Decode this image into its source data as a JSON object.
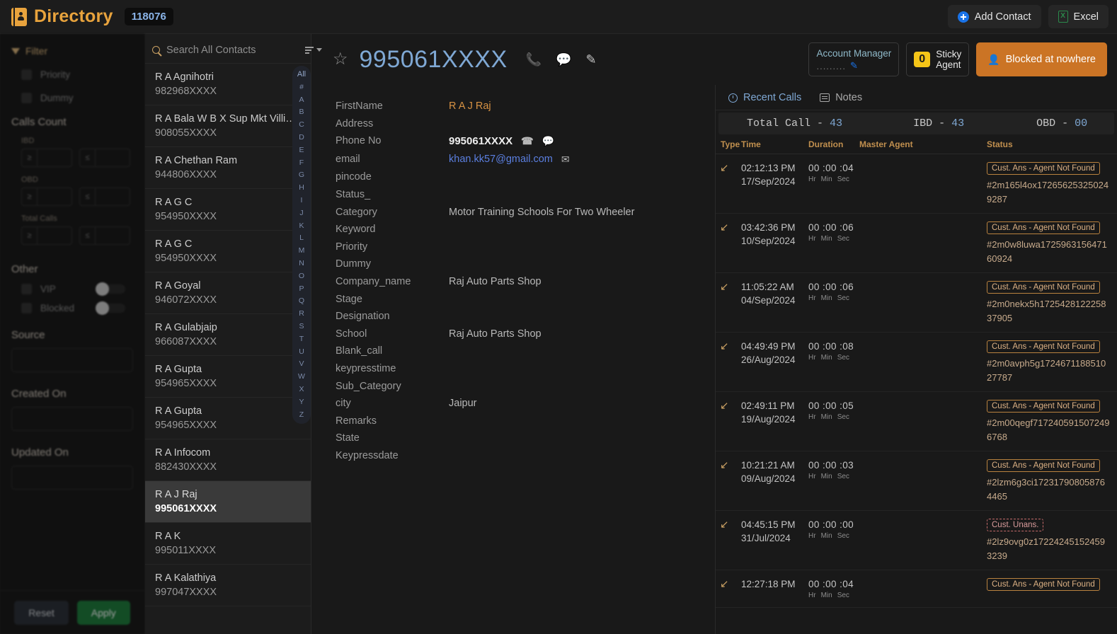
{
  "topbar": {
    "brand_title": "Directory",
    "brand_count": "118076",
    "add_contact_label": "Add Contact",
    "excel_label": "Excel",
    "brand_color": "#e8a33d",
    "count_color": "#8ab4e8"
  },
  "filter": {
    "title": "Filter",
    "checkboxes": [
      {
        "label": "Priority"
      },
      {
        "label": "Dummy"
      }
    ],
    "calls_count_title": "Calls Count",
    "calls_groups": [
      {
        "label": "IBD",
        "op_min": "≥",
        "op_max": "≤",
        "min": "",
        "max": ""
      },
      {
        "label": "OBD",
        "op_min": "≥",
        "op_max": "≤",
        "min": "",
        "max": ""
      },
      {
        "label": "Total Calls",
        "op_min": "≥",
        "op_max": "≤",
        "min": "",
        "max": ""
      }
    ],
    "other_title": "Other",
    "toggles": [
      {
        "label": "VIP"
      },
      {
        "label": "Blocked"
      }
    ],
    "text_fields": [
      {
        "label": "Source",
        "value": ""
      },
      {
        "label": "Created On",
        "value": ""
      },
      {
        "label": "Updated On",
        "value": ""
      }
    ],
    "reset_label": "Reset",
    "apply_label": "Apply"
  },
  "list": {
    "search_placeholder": "Search All Contacts",
    "search_value": "",
    "alpha_index": [
      "All",
      "#",
      "A",
      "B",
      "C",
      "D",
      "E",
      "F",
      "G",
      "H",
      "I",
      "J",
      "K",
      "L",
      "M",
      "N",
      "O",
      "P",
      "Q",
      "R",
      "S",
      "T",
      "U",
      "V",
      "W",
      "X",
      "Y",
      "Z"
    ],
    "contacts": [
      {
        "name": "R A Agnihotri",
        "phone": "982968XXXX",
        "active": false
      },
      {
        "name": "R A Bala W B X Sup Mkt Villivak…",
        "phone": "908055XXXX",
        "active": false
      },
      {
        "name": "R A Chethan Ram",
        "phone": "944806XXXX",
        "active": false
      },
      {
        "name": "R A G C",
        "phone": "954950XXXX",
        "active": false
      },
      {
        "name": "R A G C",
        "phone": "954950XXXX",
        "active": false
      },
      {
        "name": "R A Goyal",
        "phone": "946072XXXX",
        "active": false
      },
      {
        "name": "R A Gulabjaip",
        "phone": "966087XXXX",
        "active": false
      },
      {
        "name": "R A Gupta",
        "phone": "954965XXXX",
        "active": false
      },
      {
        "name": "R A Gupta",
        "phone": "954965XXXX",
        "active": false
      },
      {
        "name": "R A Infocom",
        "phone": "882430XXXX",
        "active": false
      },
      {
        "name": "R A J Raj",
        "phone": "995061XXXX",
        "active": true
      },
      {
        "name": "R A K",
        "phone": "995011XXXX",
        "active": false
      },
      {
        "name": "R A Kalathiya",
        "phone": "997047XXXX",
        "active": false
      }
    ]
  },
  "detail": {
    "phone_title": "995061XXXX",
    "account_manager": {
      "title": "Account Manager",
      "value": "........."
    },
    "sticky": {
      "count": "0",
      "label_line1": "Sticky",
      "label_line2": "Agent"
    },
    "blocked_label": "Blocked at nowhere",
    "blocked_color": "#cb7425",
    "fields": [
      {
        "key": "FirstName",
        "value": "R A J Raj",
        "style": "orange"
      },
      {
        "key": "Address",
        "value": "",
        "style": ""
      },
      {
        "key": "Phone No",
        "value": "995061XXXX",
        "style": "bold",
        "actions": [
          "call-icon",
          "sms-icon"
        ]
      },
      {
        "key": "email",
        "value": "khan.kk57@gmail.com",
        "style": "mail",
        "actions": [
          "mail-icon"
        ]
      },
      {
        "key": "pincode",
        "value": "",
        "style": ""
      },
      {
        "key": "Status_",
        "value": "",
        "style": ""
      },
      {
        "key": "Category",
        "value": "Motor Training Schools For Two Wheeler",
        "style": ""
      },
      {
        "key": "Keyword",
        "value": "",
        "style": ""
      },
      {
        "key": "Priority",
        "value": "",
        "style": ""
      },
      {
        "key": "Dummy",
        "value": "",
        "style": ""
      },
      {
        "key": "Company_name",
        "value": "Raj Auto Parts Shop",
        "style": ""
      },
      {
        "key": "Stage",
        "value": "",
        "style": ""
      },
      {
        "key": "Designation",
        "value": "",
        "style": ""
      },
      {
        "key": "School",
        "value": "Raj Auto Parts Shop",
        "style": ""
      },
      {
        "key": "Blank_call",
        "value": "",
        "style": ""
      },
      {
        "key": "keypresstime",
        "value": "",
        "style": ""
      },
      {
        "key": "Sub_Category",
        "value": "",
        "style": ""
      },
      {
        "key": "city",
        "value": "Jaipur",
        "style": ""
      },
      {
        "key": "Remarks",
        "value": "",
        "style": ""
      },
      {
        "key": "State",
        "value": "",
        "style": ""
      },
      {
        "key": "Keypressdate",
        "value": "",
        "style": ""
      }
    ]
  },
  "calls": {
    "tabs": [
      {
        "label": "Recent Calls",
        "icon": "clock-icon",
        "active": true
      },
      {
        "label": "Notes",
        "icon": "note-icon",
        "active": false
      }
    ],
    "totals": {
      "total_label": "Total Call -",
      "total_value": "43",
      "ibd_label": "IBD -",
      "ibd_value": "43",
      "obd_label": "OBD -",
      "obd_value": "00"
    },
    "columns": [
      "Type",
      "Time",
      "Duration",
      "Master Agent",
      "Status"
    ],
    "duration_units": [
      "Hr",
      "Min",
      "Sec"
    ],
    "rows": [
      {
        "type": "incoming-call-icon",
        "time": "02:12:13 PM",
        "date": "17/Sep/2024",
        "duration": "00 :00 :04",
        "agent": "",
        "status": "Cust. Ans - Agent Not Found",
        "status_kind": "ans",
        "ref": "#2m165l4ox172656253250249287"
      },
      {
        "type": "incoming-call-icon",
        "time": "03:42:36 PM",
        "date": "10/Sep/2024",
        "duration": "00 :00 :06",
        "agent": "",
        "status": "Cust. Ans - Agent Not Found",
        "status_kind": "ans",
        "ref": "#2m0w8luwa172596315647160924"
      },
      {
        "type": "incoming-call-icon",
        "time": "11:05:22 AM",
        "date": "04/Sep/2024",
        "duration": "00 :00 :06",
        "agent": "",
        "status": "Cust. Ans - Agent Not Found",
        "status_kind": "ans",
        "ref": "#2m0nekx5h172542812225837905"
      },
      {
        "type": "incoming-call-icon",
        "time": "04:49:49 PM",
        "date": "26/Aug/2024",
        "duration": "00 :00 :08",
        "agent": "",
        "status": "Cust. Ans - Agent Not Found",
        "status_kind": "ans",
        "ref": "#2m0avph5g172467118851027787"
      },
      {
        "type": "incoming-call-icon",
        "time": "02:49:11 PM",
        "date": "19/Aug/2024",
        "duration": "00 :00 :05",
        "agent": "",
        "status": "Cust. Ans - Agent Not Found",
        "status_kind": "ans",
        "ref": "#2m00qegf7172405915072496768"
      },
      {
        "type": "incoming-call-icon",
        "time": "10:21:21 AM",
        "date": "09/Aug/2024",
        "duration": "00 :00 :03",
        "agent": "",
        "status": "Cust. Ans - Agent Not Found",
        "status_kind": "ans",
        "ref": "#2lzm6g3ci172317908058764465"
      },
      {
        "type": "incoming-call-icon",
        "time": "04:45:15 PM",
        "date": "31/Jul/2024",
        "duration": "00 :00 :00",
        "agent": "",
        "status": "Cust. Unans.",
        "status_kind": "unans",
        "ref": "#2lz9ovg0z172242451524593239"
      },
      {
        "type": "incoming-call-icon",
        "time": "12:27:18 PM",
        "date": "",
        "duration": "00 :00 :04",
        "agent": "",
        "status": "Cust. Ans - Agent Not Found",
        "status_kind": "ans",
        "ref": ""
      }
    ]
  }
}
